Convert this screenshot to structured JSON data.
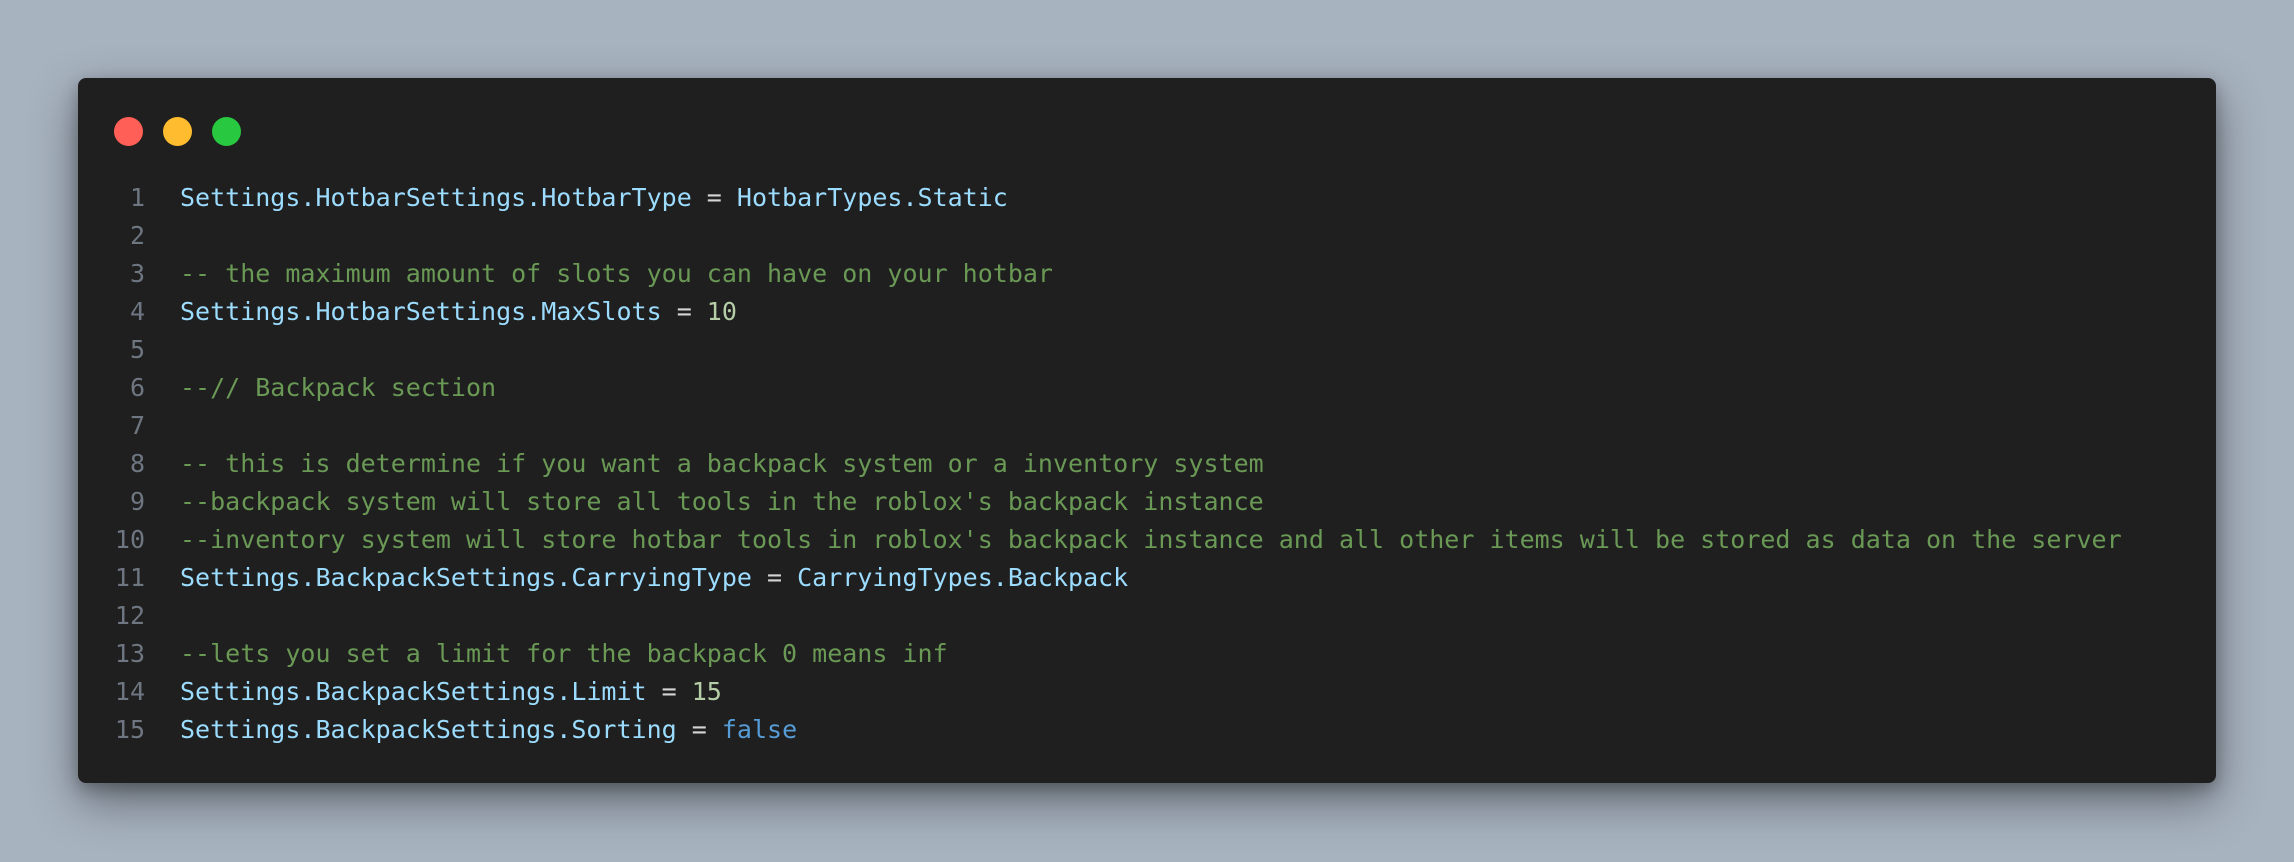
{
  "window": {
    "controls": [
      {
        "name": "close",
        "color": "#ff5f57"
      },
      {
        "name": "minimize",
        "color": "#febc2e"
      },
      {
        "name": "maximize",
        "color": "#28c840"
      }
    ]
  },
  "colors": {
    "background": "#a8b3c0",
    "editor_background": "#1f1f1f",
    "line_number": "#6e7681",
    "identifier": "#9cdcfe",
    "operator": "#d4d4d4",
    "number": "#b5cea8",
    "comment": "#6a9955",
    "keyword": "#569cd6"
  },
  "code": {
    "lines": [
      {
        "number": "1",
        "tokens": [
          {
            "t": "ident",
            "v": "Settings.HotbarSettings.HotbarType"
          },
          {
            "t": "op",
            "v": " = "
          },
          {
            "t": "ident",
            "v": "HotbarTypes.Static"
          }
        ]
      },
      {
        "number": "2",
        "tokens": []
      },
      {
        "number": "3",
        "tokens": [
          {
            "t": "comment",
            "v": "-- the maximum amount of slots you can have on your hotbar"
          }
        ]
      },
      {
        "number": "4",
        "tokens": [
          {
            "t": "ident",
            "v": "Settings.HotbarSettings.MaxSlots"
          },
          {
            "t": "op",
            "v": " = "
          },
          {
            "t": "number",
            "v": "10"
          }
        ]
      },
      {
        "number": "5",
        "tokens": []
      },
      {
        "number": "6",
        "tokens": [
          {
            "t": "comment",
            "v": "--// Backpack section"
          }
        ]
      },
      {
        "number": "7",
        "tokens": []
      },
      {
        "number": "8",
        "tokens": [
          {
            "t": "comment",
            "v": "-- this is determine if you want a backpack system or a inventory system"
          }
        ]
      },
      {
        "number": "9",
        "tokens": [
          {
            "t": "comment",
            "v": "--backpack system will store all tools in the roblox's backpack instance"
          }
        ]
      },
      {
        "number": "10",
        "tokens": [
          {
            "t": "comment",
            "v": "--inventory system will store hotbar tools in roblox's backpack instance and all other items will be stored as data on the server"
          }
        ]
      },
      {
        "number": "11",
        "tokens": [
          {
            "t": "ident",
            "v": "Settings.BackpackSettings.CarryingType"
          },
          {
            "t": "op",
            "v": " = "
          },
          {
            "t": "ident",
            "v": "CarryingTypes.Backpack"
          }
        ]
      },
      {
        "number": "12",
        "tokens": []
      },
      {
        "number": "13",
        "tokens": [
          {
            "t": "comment",
            "v": "--lets you set a limit for the backpack 0 means inf"
          }
        ]
      },
      {
        "number": "14",
        "tokens": [
          {
            "t": "ident",
            "v": "Settings.BackpackSettings.Limit"
          },
          {
            "t": "op",
            "v": " = "
          },
          {
            "t": "number",
            "v": "15"
          }
        ]
      },
      {
        "number": "15",
        "tokens": [
          {
            "t": "ident",
            "v": "Settings.BackpackSettings.Sorting"
          },
          {
            "t": "op",
            "v": " = "
          },
          {
            "t": "keyword",
            "v": "false"
          }
        ]
      }
    ]
  }
}
